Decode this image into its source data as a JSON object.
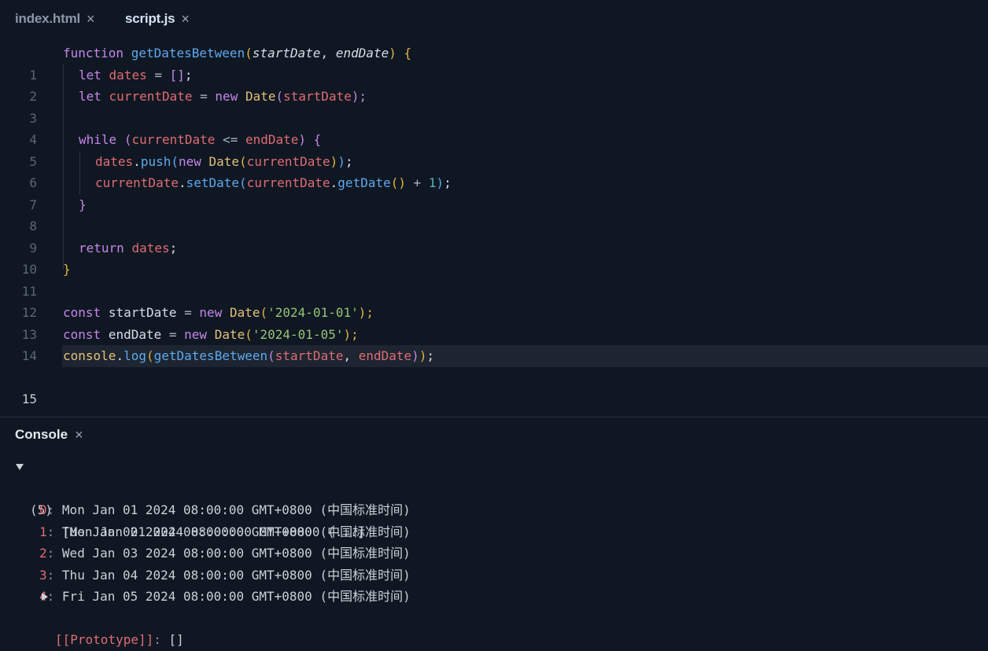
{
  "tabs": [
    {
      "label": "index.html",
      "close": "×"
    },
    {
      "label": "script.js",
      "close": "×"
    }
  ],
  "editor": {
    "line_numbers": [
      "1",
      "2",
      "3",
      "4",
      "5",
      "6",
      "7",
      "8",
      "9",
      "10",
      "11",
      "12",
      "13",
      "14",
      "15"
    ],
    "active_line": 15,
    "tokens": {
      "l1": [
        "function",
        " ",
        "getDatesBetween",
        "(",
        "startDate",
        ", ",
        "endDate",
        ")",
        " ",
        "{"
      ],
      "l2": [
        "let",
        " ",
        "dates",
        " = ",
        "[]",
        ";"
      ],
      "l3": [
        "let",
        " ",
        "currentDate",
        " = ",
        "new",
        " ",
        "Date",
        "(",
        "startDate",
        ");"
      ],
      "l5": [
        "while",
        " ",
        "(",
        "currentDate",
        " <= ",
        "endDate",
        ")",
        " ",
        "{"
      ],
      "l6": [
        "dates",
        ".",
        "push",
        "(",
        "new",
        " ",
        "Date",
        "(",
        "currentDate",
        ")",
        ")",
        ";"
      ],
      "l7": [
        "currentDate",
        ".",
        "setDate",
        "(",
        "currentDate",
        ".",
        "getDate",
        "()",
        " + ",
        "1",
        ")",
        ";"
      ],
      "l8": [
        "}"
      ],
      "l10": [
        "return",
        " ",
        "dates",
        ";"
      ],
      "l11": [
        "}"
      ],
      "l13": [
        "const",
        " ",
        "startDate",
        " = ",
        "new",
        " ",
        "Date",
        "(",
        "'2024-01-01'",
        ");"
      ],
      "l14": [
        "const",
        " ",
        "endDate",
        " = ",
        "new",
        " ",
        "Date",
        "(",
        "'2024-01-05'",
        ");"
      ],
      "l15": [
        "console",
        ".",
        "log",
        "(",
        "getDatesBetween",
        "(",
        "startDate",
        ", ",
        "endDate",
        ")",
        ")",
        ";"
      ]
    }
  },
  "console": {
    "title": "Console",
    "close": "×",
    "summary": {
      "count": "(5)",
      "preview": "[Mon Jan 01 2024 08:00:00 GMT+0800 (...]"
    },
    "entries": [
      {
        "index": "0",
        "value": "Mon Jan 01 2024 08:00:00 GMT+0800 (中国标准时间)"
      },
      {
        "index": "1",
        "value": "Tue Jan 02 2024 08:00:00 GMT+0800 (中国标准时间)"
      },
      {
        "index": "2",
        "value": "Wed Jan 03 2024 08:00:00 GMT+0800 (中国标准时间)"
      },
      {
        "index": "3",
        "value": "Thu Jan 04 2024 08:00:00 GMT+0800 (中国标准时间)"
      },
      {
        "index": "4",
        "value": "Fri Jan 05 2024 08:00:00 GMT+0800 (中国标准时间)"
      }
    ],
    "prototype": {
      "key": "[[Prototype]]",
      "value": "[]"
    }
  },
  "colors": {
    "background": "#0f1722",
    "keyword": "#c586e8",
    "function": "#5fa8f0",
    "type": "#e6c07b",
    "variable": "#e06c75",
    "string": "#98c379",
    "number": "#56b6c2"
  }
}
